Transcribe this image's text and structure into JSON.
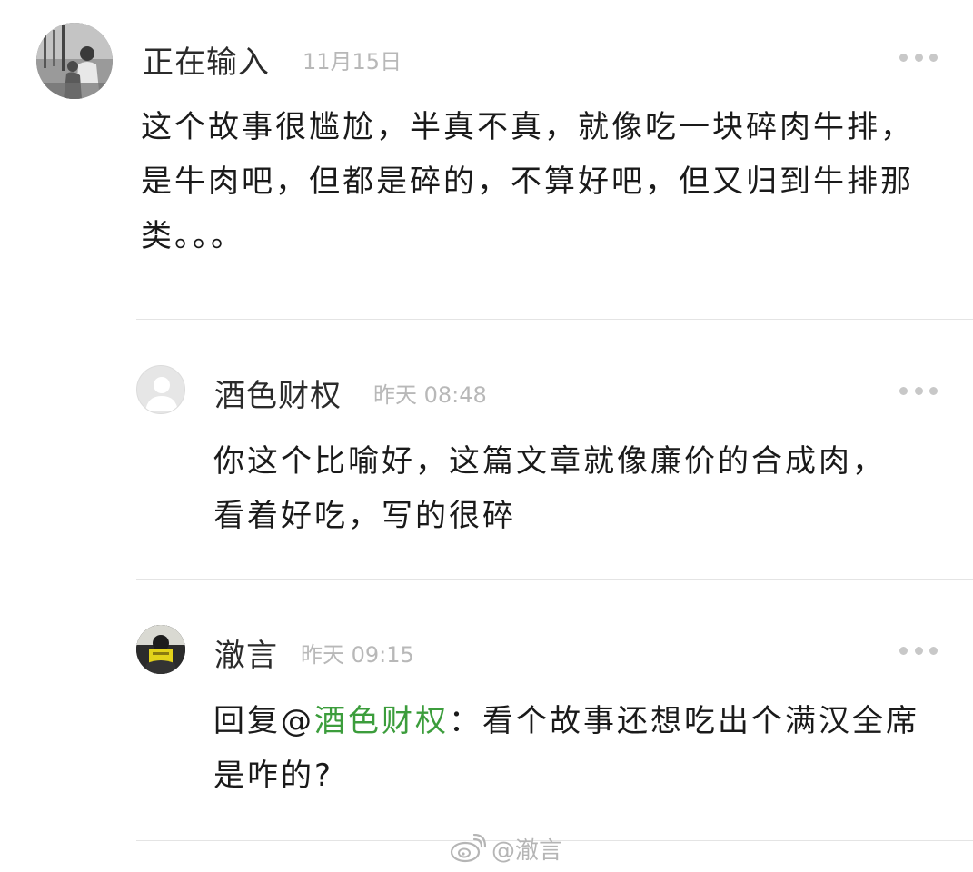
{
  "comments": [
    {
      "username": "正在输入",
      "time": "11月15日",
      "text": "这个故事很尴尬，半真不真，就像吃一块碎肉牛排，是牛肉吧，但都是碎的，不算好吧，但又归到牛排那类。。。",
      "avatar": "user-photo-avatar"
    },
    {
      "username": "酒色财权",
      "time": "昨天 08:48",
      "text": "你这个比喻好，这篇文章就像廉价的合成肉，看着好吃，写的很碎",
      "avatar": "default-avatar"
    },
    {
      "username": "澈言",
      "time": "昨天 09:15",
      "reply_prefix": "回复@",
      "reply_to": "酒色财权",
      "text": "：看个故事还想吃出个满汉全席是咋的?",
      "avatar": "user-photo-avatar"
    }
  ],
  "more_icon": "more-dots-icon",
  "watermark": {
    "icon": "weibo-logo-icon",
    "text": "@澈言"
  },
  "colors": {
    "mention": "#3c9d3c",
    "time": "#b8b8b8",
    "divider": "#e4e4e4",
    "dots": "#c8c8c8"
  }
}
